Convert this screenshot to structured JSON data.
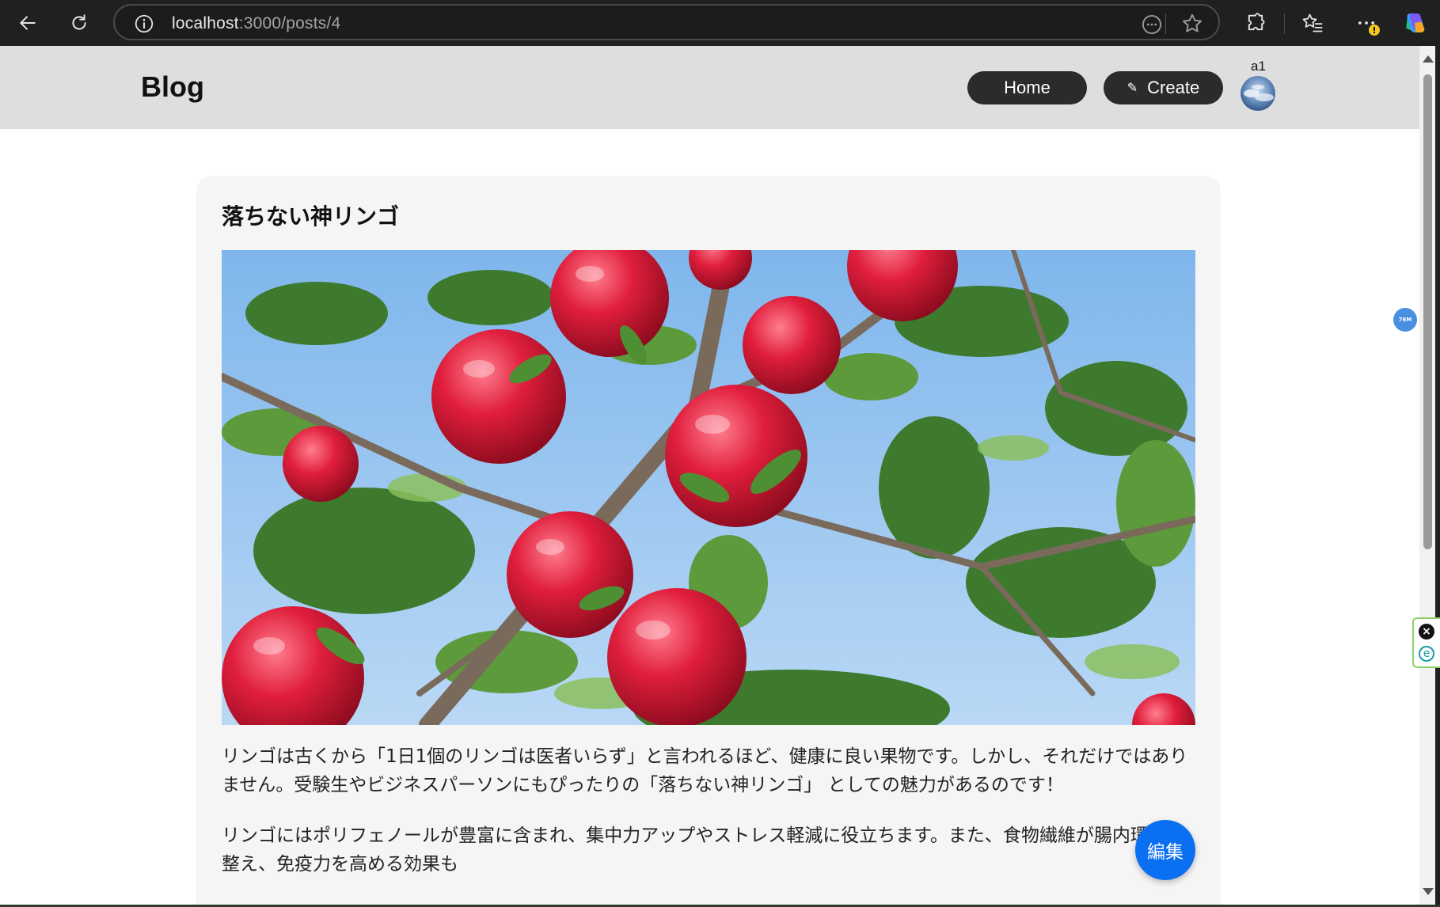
{
  "browser": {
    "url_host": "localhost",
    "url_rest": ":3000/posts/4",
    "icons": {
      "back": "back-arrow-icon",
      "reload": "reload-icon",
      "site_info": "info-icon",
      "reader": "read-aloud-icon",
      "favorite": "star-icon",
      "extensions": "puzzle-icon",
      "favorites": "favorites-icon",
      "more": "more-icon",
      "copilot": "copilot-icon"
    },
    "more_badge": "!"
  },
  "header": {
    "brand": "Blog",
    "home_label": "Home",
    "create_label": "Create",
    "create_icon": "pencil-icon",
    "user_name": "a1"
  },
  "post": {
    "title": "落ちない神リンゴ",
    "image": "apple-tree-photo",
    "paragraph_1": "リンゴは古くから「1日1個のリンゴは医者いらず」と言われるほど、健康に良い果物です。しかし、それだけではありません。受験生やビジネスパーソンにもぴったりの「落ちない神リンゴ」 としての魅力があるのです！",
    "paragraph_2": "リンゴにはポリフェノールが豊富に含まれ、集中力アップやストレス軽減に役立ちます。また、食物繊維が腸内環境を整え、免疫力を高める効果も",
    "edit_label": "編集"
  },
  "side": {
    "badge_text": "76M"
  },
  "colors": {
    "chrome_bg": "#202020",
    "header_bg": "#dedede",
    "pill_bg": "#2b2b2b",
    "card_bg": "#f5f5f5",
    "fab_bg": "#0a6ff0"
  }
}
